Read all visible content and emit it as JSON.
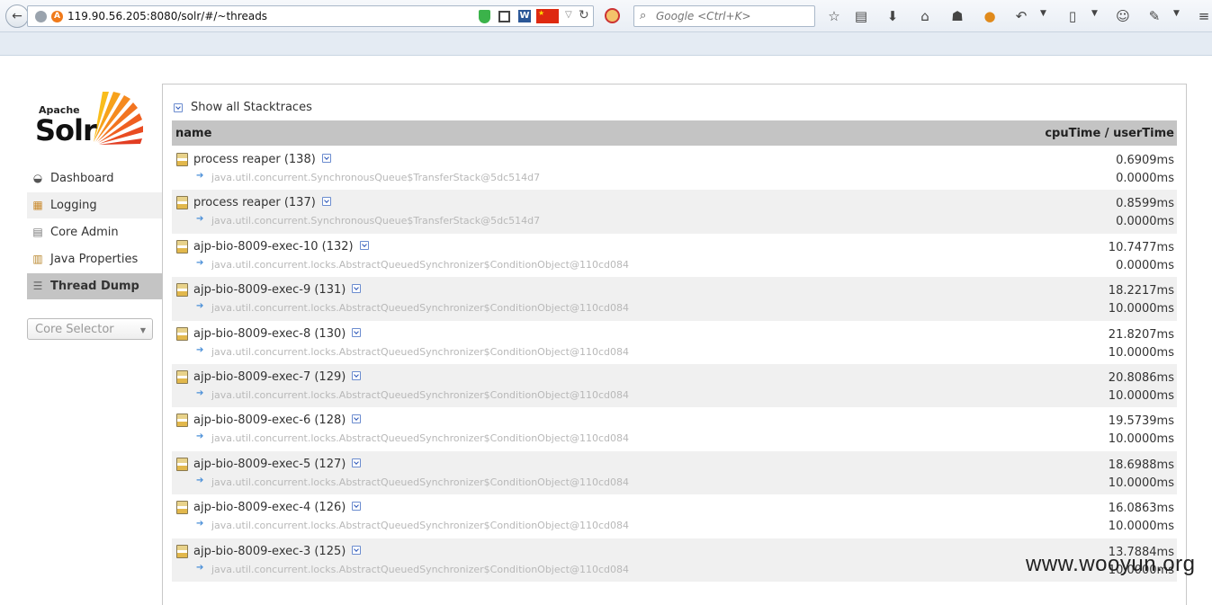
{
  "browser": {
    "url": "119.90.56.205:8080/solr/#/~threads",
    "search_placeholder": "Google <Ctrl+K>",
    "urlbar_icons": [
      "globe-icon",
      "site-a-icon",
      "shield-icon",
      "qr-icon",
      "word-icon",
      "china-flag-icon",
      "dropdown-icon",
      "reload-icon"
    ],
    "toolbar_icons": [
      "bookmark-star-icon",
      "reading-list-icon",
      "download-icon",
      "home-icon",
      "user-icon",
      "addon-icon",
      "undo-icon",
      "screenshot-icon",
      "chat-icon",
      "tools-icon",
      "menu-icon"
    ]
  },
  "logo": {
    "apache": "Apache",
    "solr": "Solr"
  },
  "nav": {
    "items": [
      {
        "label": "Dashboard",
        "icon": "dashboard-icon"
      },
      {
        "label": "Logging",
        "icon": "logging-icon"
      },
      {
        "label": "Core Admin",
        "icon": "core-admin-icon"
      },
      {
        "label": "Java Properties",
        "icon": "java-properties-icon"
      },
      {
        "label": "Thread Dump",
        "icon": "thread-dump-icon",
        "active": true
      }
    ],
    "core_selector": "Core Selector"
  },
  "threads": {
    "show_all": "Show all Stacktraces",
    "col_name": "name",
    "col_time": "cpuTime / userTime",
    "rows": [
      {
        "name": "process reaper (138)",
        "trace": "java.util.concurrent.SynchronousQueue$TransferStack@5dc514d7",
        "cpu": "0.6909ms",
        "user": "0.0000ms"
      },
      {
        "name": "process reaper (137)",
        "trace": "java.util.concurrent.SynchronousQueue$TransferStack@5dc514d7",
        "cpu": "0.8599ms",
        "user": "0.0000ms"
      },
      {
        "name": "ajp-bio-8009-exec-10 (132)",
        "trace": "java.util.concurrent.locks.AbstractQueuedSynchronizer$ConditionObject@110cd084",
        "cpu": "10.7477ms",
        "user": "0.0000ms"
      },
      {
        "name": "ajp-bio-8009-exec-9 (131)",
        "trace": "java.util.concurrent.locks.AbstractQueuedSynchronizer$ConditionObject@110cd084",
        "cpu": "18.2217ms",
        "user": "10.0000ms"
      },
      {
        "name": "ajp-bio-8009-exec-8 (130)",
        "trace": "java.util.concurrent.locks.AbstractQueuedSynchronizer$ConditionObject@110cd084",
        "cpu": "21.8207ms",
        "user": "10.0000ms"
      },
      {
        "name": "ajp-bio-8009-exec-7 (129)",
        "trace": "java.util.concurrent.locks.AbstractQueuedSynchronizer$ConditionObject@110cd084",
        "cpu": "20.8086ms",
        "user": "10.0000ms"
      },
      {
        "name": "ajp-bio-8009-exec-6 (128)",
        "trace": "java.util.concurrent.locks.AbstractQueuedSynchronizer$ConditionObject@110cd084",
        "cpu": "19.5739ms",
        "user": "10.0000ms"
      },
      {
        "name": "ajp-bio-8009-exec-5 (127)",
        "trace": "java.util.concurrent.locks.AbstractQueuedSynchronizer$ConditionObject@110cd084",
        "cpu": "18.6988ms",
        "user": "10.0000ms"
      },
      {
        "name": "ajp-bio-8009-exec-4 (126)",
        "trace": "java.util.concurrent.locks.AbstractQueuedSynchronizer$ConditionObject@110cd084",
        "cpu": "16.0863ms",
        "user": "10.0000ms"
      },
      {
        "name": "ajp-bio-8009-exec-3 (125)",
        "trace": "java.util.concurrent.locks.AbstractQueuedSynchronizer$ConditionObject@110cd084",
        "cpu": "13.7884ms",
        "user": "10.0000ms"
      }
    ]
  },
  "watermark": "www.wooyun.org"
}
